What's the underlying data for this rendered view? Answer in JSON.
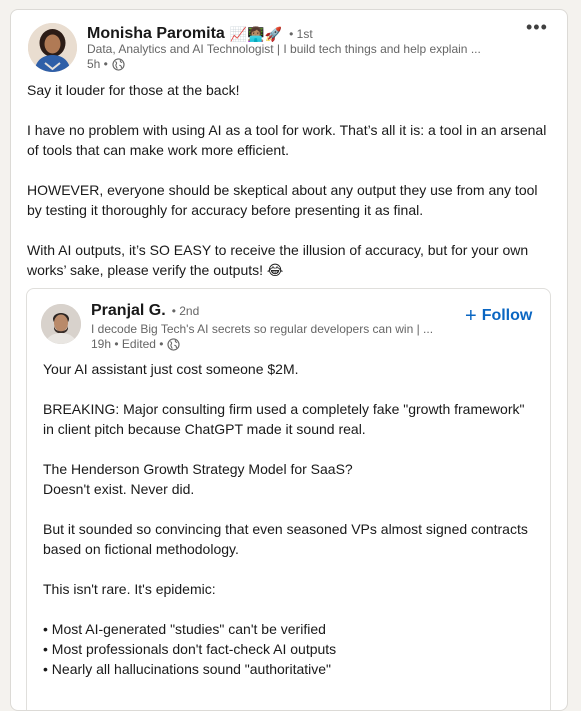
{
  "post": {
    "author": {
      "name": "Monisha Paromita",
      "emojis": "📈👩🏽‍💻🚀",
      "degree": "• 1st",
      "headline": "Data, Analytics and AI Technologist | I build tech things and help explain ...",
      "time": "5h •"
    },
    "paragraphs": [
      "Say it louder for those at the back!",
      "I have no problem with using AI as a tool for work. That’s all it is: a tool in an arsenal of tools that can make work more efficient.",
      "HOWEVER, everyone should be skeptical about any output they use from any tool by testing it thoroughly for accuracy before presenting it as final.",
      "With AI outputs, it’s SO EASY to receive the illusion of accuracy, but for your own works’ sake, please verify the outputs! 😂"
    ]
  },
  "repost": {
    "author": {
      "name": "Pranjal G.",
      "degree": "• 2nd",
      "headline": "I decode Big Tech's AI secrets so regular developers can win | ...",
      "time": "19h • Edited •"
    },
    "follow_label": "Follow",
    "paragraphs": [
      "Your AI assistant just cost someone $2M.",
      "BREAKING: Major consulting firm used a completely fake \"growth framework\" in client pitch because ChatGPT made it sound real.",
      "The Henderson Growth Strategy Model for SaaS?",
      "Doesn't exist. Never did.",
      "But it sounded so convincing that even seasoned VPs almost signed contracts based on fictional methodology.",
      "This isn't rare. It's epidemic:",
      "• Most AI-generated \"studies\" can't be verified",
      "• Most professionals don't fact-check AI outputs",
      "• Nearly all hallucinations sound \"authoritative\""
    ]
  },
  "icons": {
    "more": "more-icon",
    "globe": "globe-icon",
    "plus": "plus-icon"
  },
  "colors": {
    "link": "#0a66c2",
    "secondary_text": "#666666",
    "background": "#f4f2ee"
  }
}
